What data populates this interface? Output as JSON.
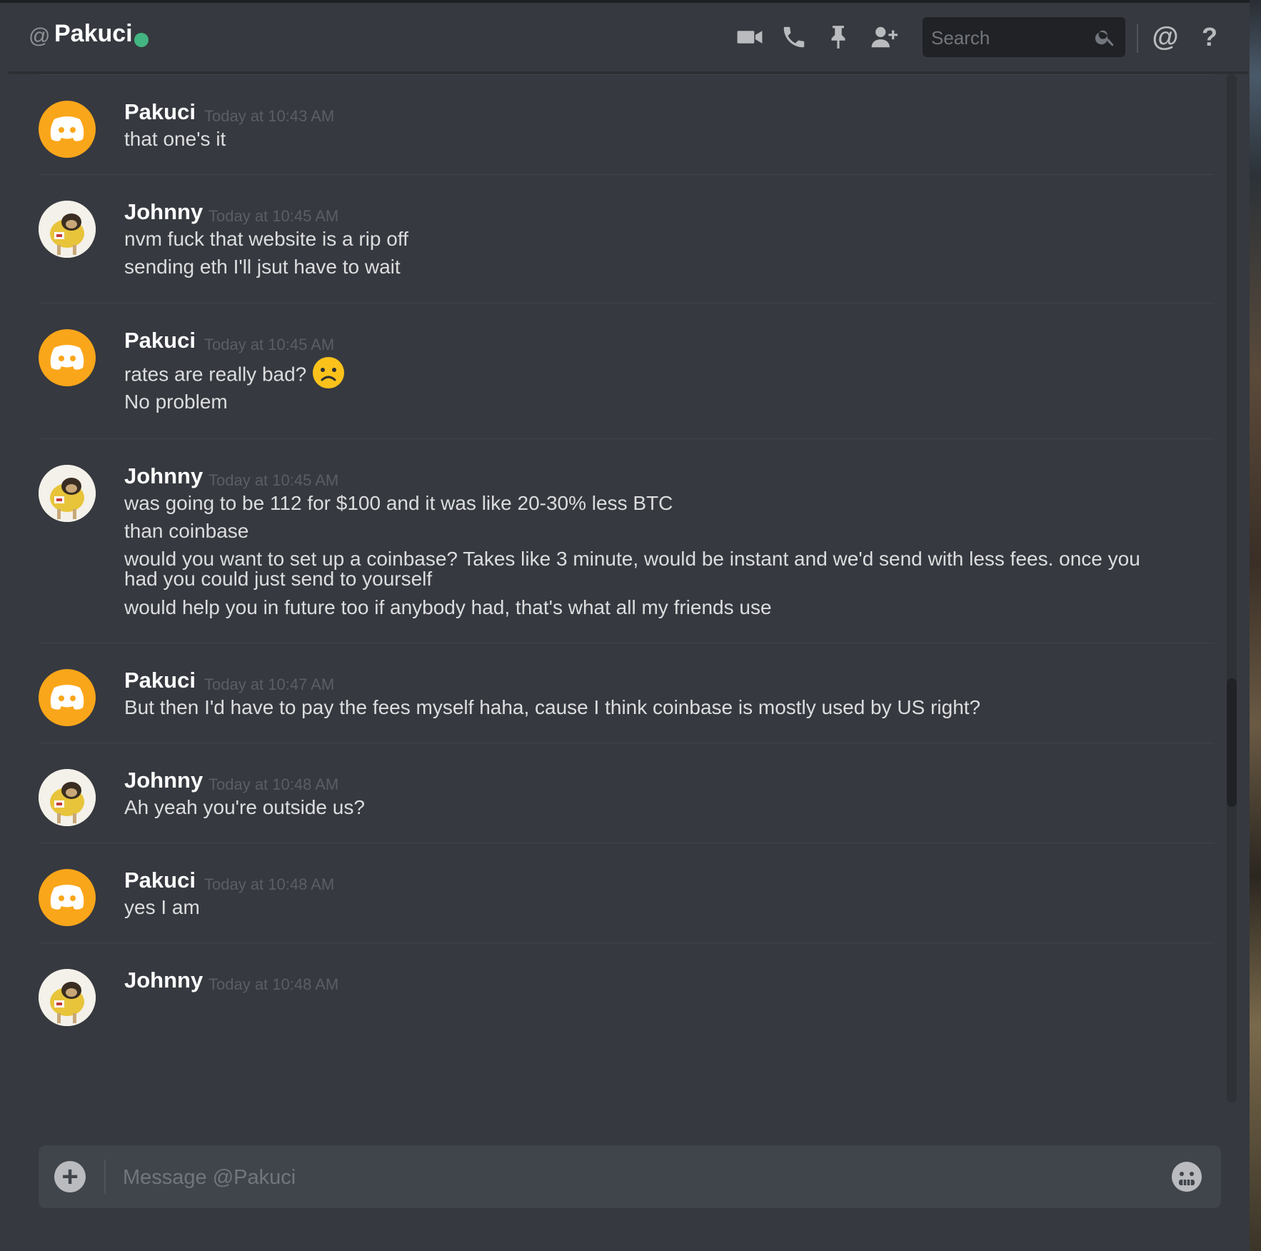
{
  "header": {
    "at_symbol": "@",
    "title": "Pakuci",
    "status_color": "#43b581",
    "icons": [
      "video-call-icon",
      "voice-call-icon",
      "pin-icon",
      "add-friend-icon",
      "mention-icon",
      "help-icon"
    ],
    "search_placeholder": "Search",
    "mention_label": "@",
    "help_label": "?"
  },
  "messages": [
    {
      "author": "Pakuci",
      "avatar": "discord-logo-avatar",
      "timestamp": "Today at 10:43 AM",
      "lines": [
        "that one's it"
      ]
    },
    {
      "author": "Johnny",
      "avatar": "pug-photo-avatar",
      "timestamp": "Today at 10:45 AM",
      "lines": [
        "nvm fuck that website is a rip off",
        "sending eth I'll jsut have to wait"
      ]
    },
    {
      "author": "Pakuci",
      "avatar": "discord-logo-avatar",
      "timestamp": "Today at 10:45 AM",
      "lines": [
        "rates are really bad?",
        "No problem"
      ],
      "emoji": "frowning-face"
    },
    {
      "author": "Johnny",
      "avatar": "pug-photo-avatar",
      "timestamp": "Today at 10:45 AM",
      "lines": [
        "was going to be 112 for $100 and it was like 20-30% less BTC",
        "than coinbase",
        "would you want to set up a coinbase? Takes like 3 minute, would be instant and we'd send with less fees. once you",
        "had you could just send to yourself",
        "would help you in future too if anybody had, that's what all my friends use"
      ]
    },
    {
      "author": "Pakuci",
      "avatar": "discord-logo-avatar",
      "timestamp": "Today at 10:47 AM",
      "lines": [
        "But then I'd have to pay the fees myself haha, cause I think coinbase is mostly used by US right?"
      ]
    },
    {
      "author": "Johnny",
      "avatar": "pug-photo-avatar",
      "timestamp": "Today at 10:48 AM",
      "lines": [
        "Ah yeah you're outside us?"
      ]
    },
    {
      "author": "Pakuci",
      "avatar": "discord-logo-avatar",
      "timestamp": "Today at 10:48 AM",
      "lines": [
        "yes I am"
      ]
    },
    {
      "author": "Johnny",
      "avatar": "pug-photo-avatar",
      "timestamp": "Today at 10:48 AM",
      "lines": []
    }
  ],
  "composer": {
    "placeholder": "Message @Pakuci",
    "attach_label": "+",
    "emoji_icon": "emoji-picker-icon"
  },
  "colors": {
    "background": "#36393f",
    "discord_orange": "#faa61a",
    "online_green": "#43b581",
    "text": "#dcddde"
  }
}
